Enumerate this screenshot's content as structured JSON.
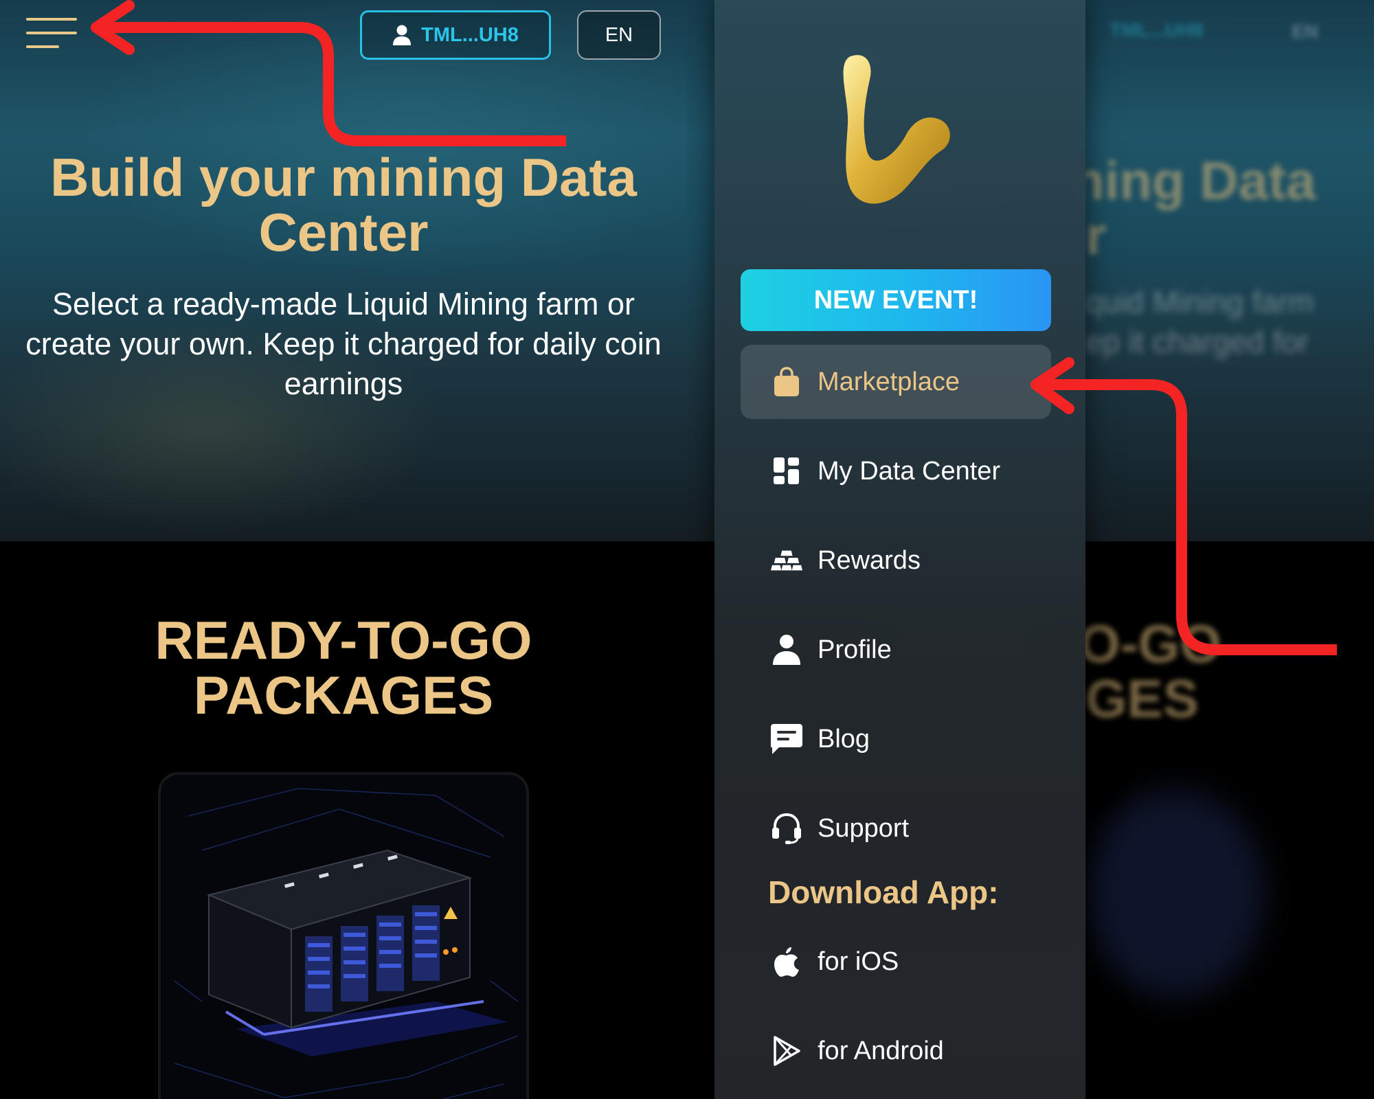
{
  "left": {
    "wallet_label": "TML...UH8",
    "lang_label": "EN",
    "hero_title": "Build your mining Data Center",
    "hero_subtitle": "Select a ready-made Liquid Mining farm or create your own. Keep it charged for daily coin earnings",
    "packages_title_line1": "READY-TO-GO",
    "packages_title_line2": "PACKAGES",
    "icons": [
      "hamburger-menu-icon",
      "user-icon"
    ]
  },
  "right": {
    "new_event_label": "NEW EVENT!",
    "menu_items": [
      {
        "label": "Marketplace",
        "icon": "shopping-bag-icon",
        "active": true
      },
      {
        "label": "My Data Center",
        "icon": "dashboard-grid-icon",
        "active": false
      },
      {
        "label": "Rewards",
        "icon": "gold-bars-icon",
        "active": false
      },
      {
        "label": "Profile",
        "icon": "user-icon",
        "active": false
      },
      {
        "label": "Blog",
        "icon": "chat-message-icon",
        "active": false
      },
      {
        "label": "Support",
        "icon": "headset-icon",
        "active": false
      }
    ],
    "download_title": "Download App:",
    "download_items": [
      {
        "label": "for iOS",
        "icon": "apple-icon"
      },
      {
        "label": "for Android",
        "icon": "google-play-icon"
      }
    ],
    "ghost": {
      "wallet_label": "TML...UH8",
      "lang_label": "EN",
      "title_fragment_1": "ning Data",
      "title_fragment_2": "r",
      "sub_fragment_1": "quid Mining farm",
      "sub_fragment_2": "ep it charged for",
      "packages_fragment_1": "O-GO",
      "packages_fragment_2": "GES"
    }
  },
  "colors": {
    "accent_gold": "#ebc686",
    "accent_cyan": "#29c0e6",
    "annotation_red": "#f42424",
    "background": "#000000"
  }
}
